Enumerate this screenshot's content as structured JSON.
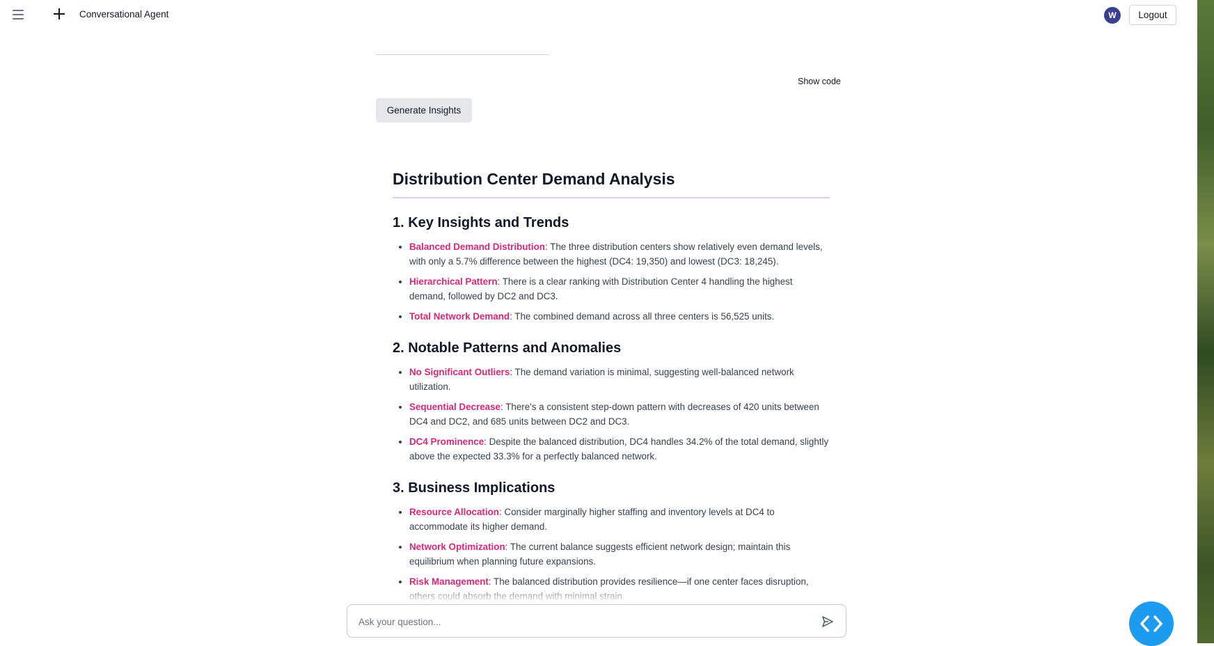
{
  "header": {
    "app_title": "Conversational Agent",
    "avatar_initial": "W",
    "logout_label": "Logout"
  },
  "toolbar": {
    "show_code_label": "Show code",
    "generate_label": "Generate Insights"
  },
  "report": {
    "title": "Distribution Center Demand Analysis",
    "sections": [
      {
        "heading": "1. Key Insights and Trends",
        "items": [
          {
            "term": "Balanced Demand Distribution",
            "text": ": The three distribution centers show relatively even demand levels, with only a 5.7% difference between the highest (DC4: 19,350) and lowest (DC3: 18,245)."
          },
          {
            "term": "Hierarchical Pattern",
            "text": ": There is a clear ranking with Distribution Center 4 handling the highest demand, followed by DC2 and DC3."
          },
          {
            "term": "Total Network Demand",
            "text": ": The combined demand across all three centers is 56,525 units."
          }
        ]
      },
      {
        "heading": "2. Notable Patterns and Anomalies",
        "items": [
          {
            "term": "No Significant Outliers",
            "text": ": The demand variation is minimal, suggesting well-balanced network utilization."
          },
          {
            "term": "Sequential Decrease",
            "text": ": There's a consistent step-down pattern with decreases of 420 units between DC4 and DC2, and 685 units between DC2 and DC3."
          },
          {
            "term": "DC4 Prominence",
            "text": ": Despite the balanced distribution, DC4 handles 34.2% of the total demand, slightly above the expected 33.3% for a perfectly balanced network."
          }
        ]
      },
      {
        "heading": "3. Business Implications",
        "items": [
          {
            "term": "Resource Allocation",
            "text": ": Consider marginally higher staffing and inventory levels at DC4 to accommodate its higher demand."
          },
          {
            "term": "Network Optimization",
            "text": ": The current balance suggests efficient network design; maintain this equilibrium when planning future expansions."
          },
          {
            "term": "Risk Management",
            "text": ": The balanced distribution provides resilience—if one center faces disruption, others could absorb the demand with minimal strain."
          }
        ]
      }
    ]
  },
  "chat": {
    "placeholder": "Ask your question..."
  },
  "icons": {
    "menu": "menu-icon",
    "new_chat": "plus-icon",
    "send": "send-icon",
    "code_toggle": "code-icon"
  },
  "colors": {
    "accent_term": "#db2777",
    "avatar_bg": "#3b3f8f",
    "fab_bg": "#1d9bf0",
    "title_underline": "#e9c8f0"
  }
}
